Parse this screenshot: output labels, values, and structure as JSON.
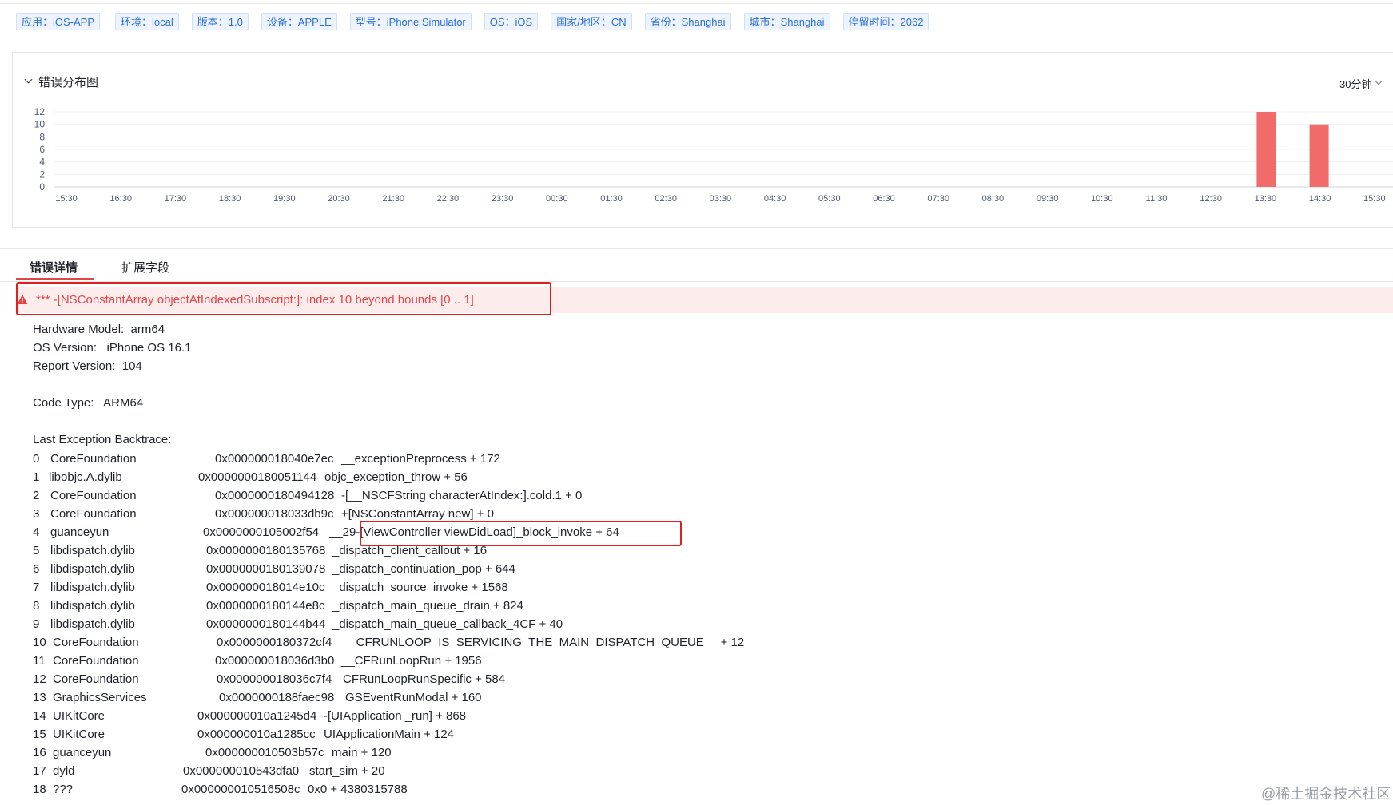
{
  "tags": [
    "应用：iOS-APP",
    "环境：local",
    "版本：1.0",
    "设备：APPLE",
    "型号：iPhone Simulator",
    "OS：iOS",
    "国家/地区：CN",
    "省份：Shanghai",
    "城市：Shanghai",
    "停留时间：2062"
  ],
  "chart_section": {
    "title": "错误分布图",
    "range_label": "30分钟"
  },
  "chart_data": {
    "type": "bar",
    "categories": [
      "15:30",
      "16:30",
      "17:30",
      "18:30",
      "19:30",
      "20:30",
      "21:30",
      "22:30",
      "23:30",
      "00:30",
      "01:30",
      "02:30",
      "03:30",
      "04:30",
      "05:30",
      "06:30",
      "07:30",
      "08:30",
      "09:30",
      "10:30",
      "11:30",
      "12:30",
      "13:30",
      "14:30",
      "15:30"
    ],
    "y_ticks": [
      0,
      2,
      4,
      6,
      8,
      10,
      12
    ],
    "ylim": [
      0,
      12
    ],
    "bars": [
      {
        "x": "13:30",
        "value": 12
      },
      {
        "x": "14:30",
        "value": 10
      }
    ],
    "bar_color": "#f26b6b",
    "grid": true
  },
  "tabs": [
    {
      "label": "错误详情",
      "active": true
    },
    {
      "label": "扩展字段",
      "active": false
    }
  ],
  "error": {
    "icon": "warning-icon",
    "message": "*** -[NSConstantArray objectAtIndexedSubscript:]: index 10 beyond bounds [0 .. 1]",
    "color": "#e0454a"
  },
  "info_lines": [
    "Hardware Model:  arm64",
    "OS Version:   iPhone OS 16.1",
    "Report Version:  104",
    "Code Type:   ARM64",
    "Last Exception Backtrace:"
  ],
  "backtrace": [
    {
      "idx": "0",
      "lib": "CoreFoundation",
      "addr": "0x000000018040e7ec",
      "sym": "__exceptionPreprocess + 172"
    },
    {
      "idx": "1",
      "lib": "libobjc.A.dylib",
      "addr": "0x0000000180051144",
      "sym": "objc_exception_throw + 56"
    },
    {
      "idx": "2",
      "lib": "CoreFoundation",
      "addr": "0x0000000180494128",
      "sym": "-[__NSCFString characterAtIndex:].cold.1 + 0"
    },
    {
      "idx": "3",
      "lib": "CoreFoundation",
      "addr": "0x000000018033db9c",
      "sym": "+[NSConstantArray new] + 0"
    },
    {
      "idx": "4",
      "lib": "guanceyun",
      "addr": "0x0000000105002f54",
      "sym": "__29-[ViewController viewDidLoad]_block_invoke + 64"
    },
    {
      "idx": "5",
      "lib": "libdispatch.dylib",
      "addr": "0x0000000180135768",
      "sym": "_dispatch_client_callout + 16"
    },
    {
      "idx": "6",
      "lib": "libdispatch.dylib",
      "addr": "0x0000000180139078",
      "sym": "_dispatch_continuation_pop + 644"
    },
    {
      "idx": "7",
      "lib": "libdispatch.dylib",
      "addr": "0x000000018014e10c",
      "sym": "_dispatch_source_invoke + 1568"
    },
    {
      "idx": "8",
      "lib": "libdispatch.dylib",
      "addr": "0x0000000180144e8c",
      "sym": "_dispatch_main_queue_drain + 824"
    },
    {
      "idx": "9",
      "lib": "libdispatch.dylib",
      "addr": "0x0000000180144b44",
      "sym": "_dispatch_main_queue_callback_4CF + 40"
    },
    {
      "idx": "10",
      "lib": "CoreFoundation",
      "addr": "0x0000000180372cf4",
      "sym": "__CFRUNLOOP_IS_SERVICING_THE_MAIN_DISPATCH_QUEUE__ + 12"
    },
    {
      "idx": "11",
      "lib": "CoreFoundation",
      "addr": "0x000000018036d3b0",
      "sym": "__CFRunLoopRun + 1956"
    },
    {
      "idx": "12",
      "lib": "CoreFoundation",
      "addr": "0x000000018036c7f4",
      "sym": "CFRunLoopRunSpecific + 584"
    },
    {
      "idx": "13",
      "lib": "GraphicsServices",
      "addr": "0x0000000188faec98",
      "sym": "GSEventRunModal + 160"
    },
    {
      "idx": "14",
      "lib": "UIKitCore",
      "addr": "0x000000010a1245d4",
      "sym": "-[UIApplication _run] + 868"
    },
    {
      "idx": "15",
      "lib": "UIKitCore",
      "addr": "0x000000010a1285cc",
      "sym": "UIApplicationMain + 124"
    },
    {
      "idx": "16",
      "lib": "guanceyun",
      "addr": "0x000000010503b57c",
      "sym": "main + 120"
    },
    {
      "idx": "17",
      "lib": "dyld",
      "addr": "0x000000010543dfa0",
      "sym": "start_sim + 20"
    },
    {
      "idx": "18",
      "lib": "???",
      "addr": "0x000000010516508c",
      "sym": "0x0 + 4380315788"
    }
  ],
  "watermark": "@稀土掘金技术社区"
}
